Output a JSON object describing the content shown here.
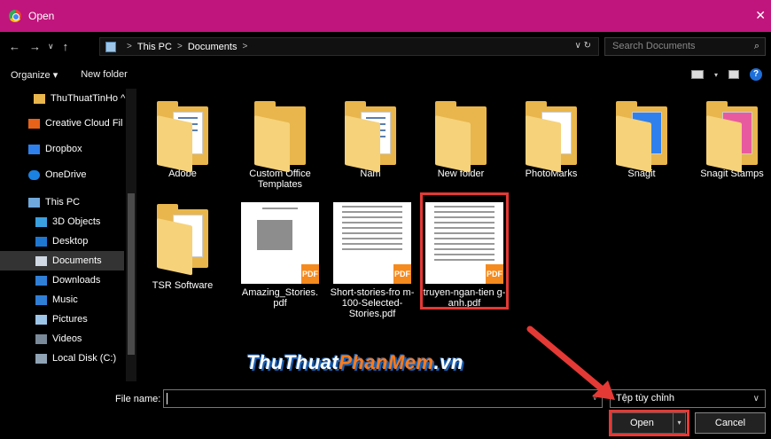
{
  "window": {
    "title": "Open",
    "close_glyph": "✕"
  },
  "nav": {
    "back": "←",
    "forward": "→",
    "recent": "∨",
    "up": "↑",
    "breadcrumb": [
      "This PC",
      "Documents"
    ],
    "breadcrumb_sep": ">",
    "addr_tail": "∨   ↻",
    "search_placeholder": "Search Documents",
    "search_glyph": "⌕"
  },
  "toolbar": {
    "organize": "Organize ▾",
    "new_folder": "New folder",
    "help": "?"
  },
  "sidebar": {
    "items": [
      {
        "label": "ThuThuatTinHo ^",
        "icon": "folder-icon"
      },
      {
        "label": "Creative Cloud Fil",
        "icon": "creative-cloud-icon"
      },
      {
        "label": "Dropbox",
        "icon": "dropbox-icon"
      },
      {
        "label": "OneDrive",
        "icon": "onedrive-icon"
      },
      {
        "label": "This PC",
        "icon": "computer-icon"
      },
      {
        "label": "3D Objects",
        "icon": "cube-icon"
      },
      {
        "label": "Desktop",
        "icon": "desktop-icon"
      },
      {
        "label": "Documents",
        "icon": "documents-icon"
      },
      {
        "label": "Downloads",
        "icon": "download-icon"
      },
      {
        "label": "Music",
        "icon": "music-icon"
      },
      {
        "label": "Pictures",
        "icon": "pictures-icon"
      },
      {
        "label": "Videos",
        "icon": "videos-icon"
      },
      {
        "label": "Local Disk (C:)",
        "icon": "disk-icon"
      }
    ]
  },
  "files": {
    "adobe": "Adobe",
    "custom_office": "Custom Office Templates",
    "nam": "Nam",
    "new_folder": "New folder",
    "photomarks": "PhotoMarks",
    "snagit": "Snagit",
    "snagit_stamps": "Snagit Stamps",
    "tsr": "TSR Software",
    "amazing": "Amazing_Stories. pdf",
    "short_stories": "Short-stories-fro m-100-Selected- Stories.pdf",
    "truyen": "truyen-ngan-tien g-anh.pdf"
  },
  "pdf_badge": "PDF",
  "bottom": {
    "file_name_label": "File name:",
    "file_name_value": "",
    "file_type": "Tệp tùy chỉnh",
    "open": "Open",
    "cancel": "Cancel",
    "dropdown_glyph": "∨"
  },
  "watermark": {
    "part1": "ThuThuat",
    "part2": "PhanMem",
    "part3": ".vn"
  },
  "colors": {
    "titlebar": "#c0157c",
    "highlight": "#e53935",
    "folder": "#e8b64c",
    "pdf_badge": "#f58a1f"
  }
}
